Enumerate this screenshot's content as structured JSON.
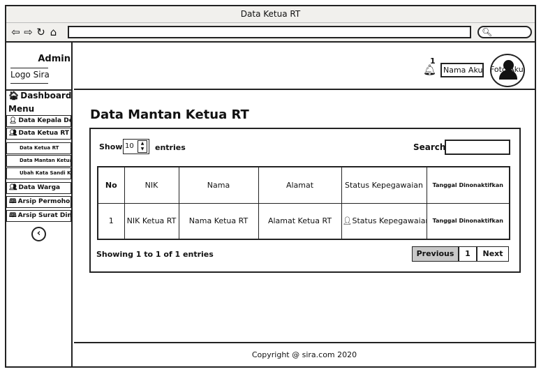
{
  "browser": {
    "title": "Data Ketua RT",
    "nav_icons": [
      "back-icon",
      "forward-icon",
      "reload-icon",
      "home-icon"
    ],
    "url": ""
  },
  "sidebar": {
    "admin_label": "Admin",
    "logo_label": "Logo Sira",
    "dashboard": "Dashboard",
    "menu_label": "Menu",
    "items": [
      {
        "label": "Data Kepala Desa",
        "icon": "user-icon"
      },
      {
        "label": "Data Ketua RT",
        "icon": "users-icon"
      },
      {
        "label": "Data Ketua RT",
        "sub": true
      },
      {
        "label": "Data Mantan Ketua",
        "sub": true
      },
      {
        "label": "Ubah Kata Sandi Ketua",
        "sub": true
      },
      {
        "label": "Data Warga",
        "icon": "users-icon"
      },
      {
        "label": "Arsip Permohonan",
        "icon": "book-icon"
      },
      {
        "label": "Arsip Surat Dinas",
        "icon": "book-icon"
      }
    ]
  },
  "header": {
    "notification_count": "1",
    "account_name": "Nama Akun",
    "avatar_label": "Foto Akun"
  },
  "main": {
    "page_title": "Data Mantan Ketua RT",
    "show_label": "Show",
    "entries_select": "10",
    "entries_label": "entries",
    "search_label": "Search",
    "table": {
      "headers": [
        "No",
        "NIK",
        "Nama",
        "Alamat",
        "Status Kepegawaian",
        "Tanggal Dinonaktifkan"
      ],
      "rows": [
        [
          "1",
          "NIK Ketua RT",
          "Nama Ketua RT",
          "Alamat Ketua RT",
          "Status Kepegawaian",
          "Tanggal Dinonaktifkan"
        ]
      ]
    },
    "info_text": "Showing 1 to 1 of 1 entries",
    "pagination": {
      "previous": "Previous",
      "page": "1",
      "next": "Next"
    }
  },
  "footer": {
    "copyright": "Copyright @ sira.com 2020"
  }
}
